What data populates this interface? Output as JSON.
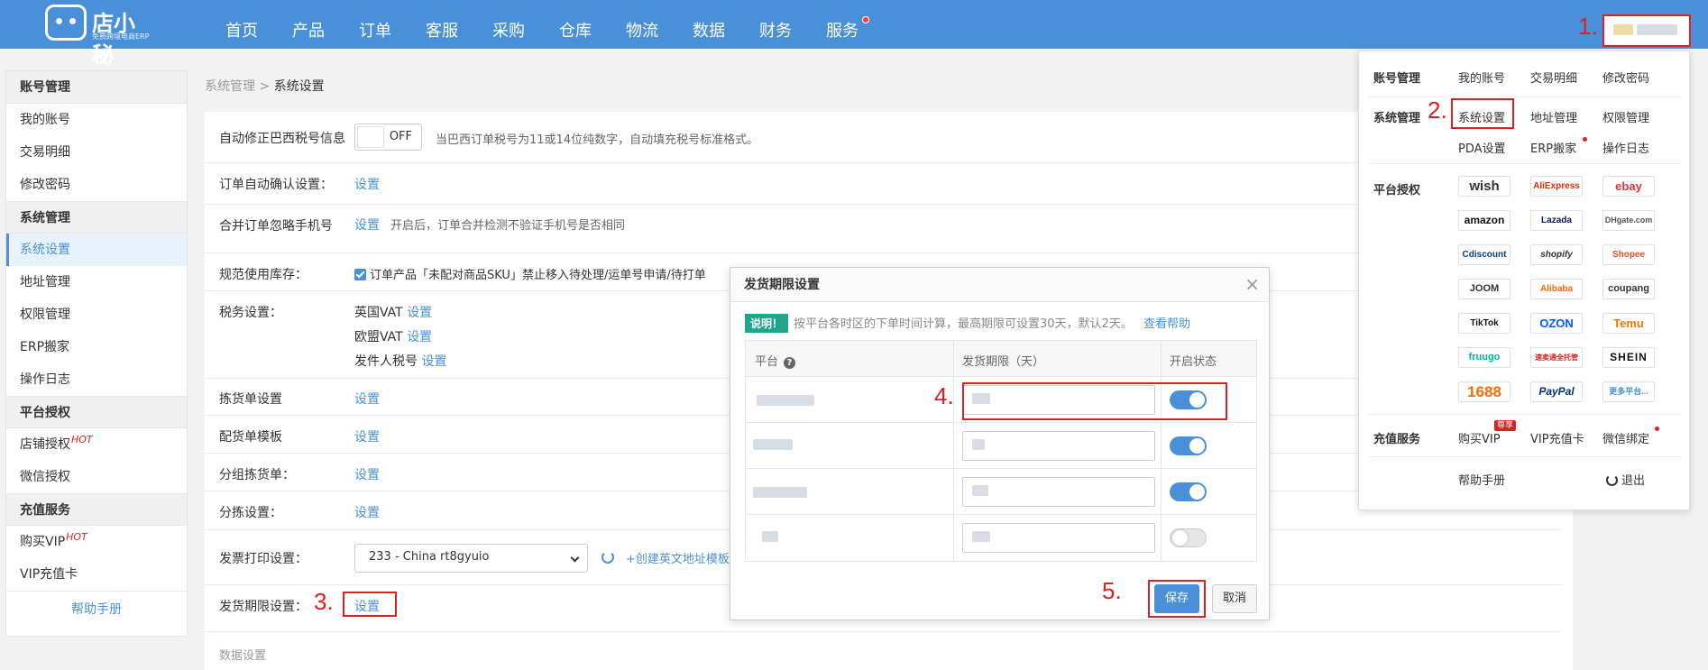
{
  "app": {
    "logo_text": "店小秘",
    "logo_sub": "免费跨境电商ERP"
  },
  "nav": [
    "首页",
    "产品",
    "订单",
    "客服",
    "采购",
    "仓库",
    "物流",
    "数据",
    "财务",
    "服务"
  ],
  "steps": [
    "1.",
    "2.",
    "3.",
    "4.",
    "5."
  ],
  "sidebar": {
    "sections": [
      {
        "title": "账号管理",
        "items": [
          "我的账号",
          "交易明细",
          "修改密码"
        ]
      },
      {
        "title": "系统管理",
        "items": [
          "系统设置",
          "地址管理",
          "权限管理",
          "ERP搬家",
          "操作日志"
        ]
      },
      {
        "title": "平台授权",
        "items": [
          "店铺授权",
          "微信授权"
        ]
      },
      {
        "title": "充值服务",
        "items": [
          "购买VIP",
          "VIP充值卡"
        ]
      }
    ],
    "hot": "HOT",
    "footer": "帮助手册"
  },
  "breadcrumb": {
    "parent": "系统管理",
    "sep": ">",
    "current": "系统设置"
  },
  "settings": {
    "fix_tax_label": "自动修正巴西税号信息",
    "switch_off": "OFF",
    "fix_tax_desc": "当巴西订单税号为11或14位纯数字，自动填充税号标准格式。",
    "auto_confirm_label": "订单自动确认设置：",
    "set": "设置",
    "merge_label": "合并订单忽略手机号",
    "merge_desc": "开启后，订单合并检测不验证手机号是否相同",
    "stock_label": "规范使用库存：",
    "stock_text": "订单产品「未配对商品SKU」禁止移入待处理/运单号申请/待打单",
    "tax_label": "税务设置：",
    "tax_uk": "英国VAT",
    "tax_eu": "欧盟VAT",
    "tax_sender": "发件人税号",
    "pick_label": "拣货单设置",
    "ship_tpl_label": "配货单模板",
    "group_pick_label": "分组拣货单：",
    "sort_label": "分拣设置：",
    "invoice_label": "发票打印设置：",
    "invoice_value": "233 - China rt8gyuio",
    "create_en_addr": "+创建英文地址模板",
    "ship_period_label": "发货期限设置：",
    "data_section": "数据设置"
  },
  "modal": {
    "title": "发货期限设置",
    "close": "×",
    "notice_badge": "说明！",
    "notice_text": "按平台各时区的下单时间计算，最高期限可设置30天，默认2天。",
    "help_link": "查看帮助",
    "col_platform": "平台",
    "col_days": "发货期限（天）",
    "col_status": "开启状态",
    "rows": [
      {
        "enabled": true
      },
      {
        "enabled": true
      },
      {
        "enabled": true
      },
      {
        "enabled": false
      }
    ],
    "save": "保存",
    "cancel": "取消"
  },
  "dropdown": {
    "account_title": "账号管理",
    "account_items": [
      "我的账号",
      "交易明细",
      "修改密码"
    ],
    "system_title": "系统管理",
    "system_items": [
      "系统设置",
      "地址管理",
      "权限管理",
      "PDA设置",
      "ERP搬家",
      "操作日志"
    ],
    "platform_title": "平台授权",
    "platforms": [
      "wish",
      "AliExpress",
      "ebay",
      "amazon",
      "Lazada",
      "DHgate.com",
      "Cdiscount",
      "shopify",
      "Shopee",
      "JOOM",
      "Alibaba",
      "coupang",
      "TikTok",
      "OZON",
      "Temu",
      "fruugo",
      "速卖通全托管",
      "SHEIN",
      "1688",
      "PayPal",
      "更多平台..."
    ],
    "recharge_title": "充值服务",
    "recharge_items": [
      "购买VIP",
      "VIP充值卡",
      "微信绑定"
    ],
    "vip_tag": "尊享",
    "help": "帮助手册",
    "logout": "退出"
  },
  "colors": {
    "brand": "#4a90d9",
    "highlight": "#e02020",
    "notice": "#20a48a"
  }
}
